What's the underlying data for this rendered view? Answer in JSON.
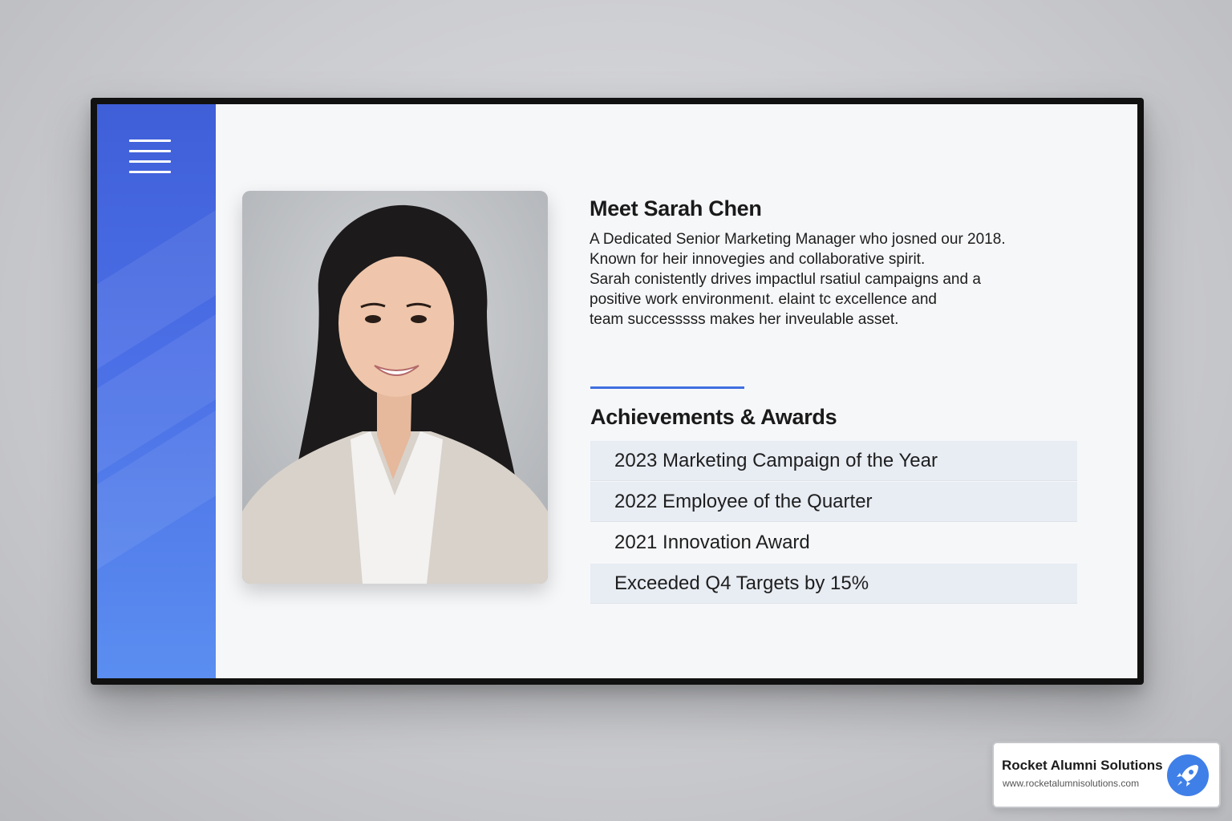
{
  "profile": {
    "heading": "Meet Sarah Chen",
    "bio_lines": [
      "A Dedicated Senior Marketing Manager who josned our 2018.",
      "Known for heir innovegies and collaborative spirit.",
      "Sarah conistently drives impactlul rsatiul campaigns and a",
      "positive work environmenıt. elaint tc excellence and",
      "team successsss makes her inveulable asset."
    ]
  },
  "achievements": {
    "title": "Achievements & Awards",
    "items": [
      "2023 Marketing Campaign of the Year",
      "2022 Employee of the Quarter",
      "2021 Innovation Award",
      "Exceeded Q4 Targets by 15%"
    ]
  },
  "brand": {
    "name": "Rocket Alumni Solutions",
    "url": "www.rocketalumnisolutions.com",
    "logo_icon": "rocket-icon",
    "accent": "#3f6fe0"
  },
  "colors": {
    "sidebar_top": "#3f5fd8",
    "sidebar_bottom": "#5b8ef0",
    "screen_bg": "#f6f7f9",
    "list_row_bg": "#e8ecf3"
  }
}
